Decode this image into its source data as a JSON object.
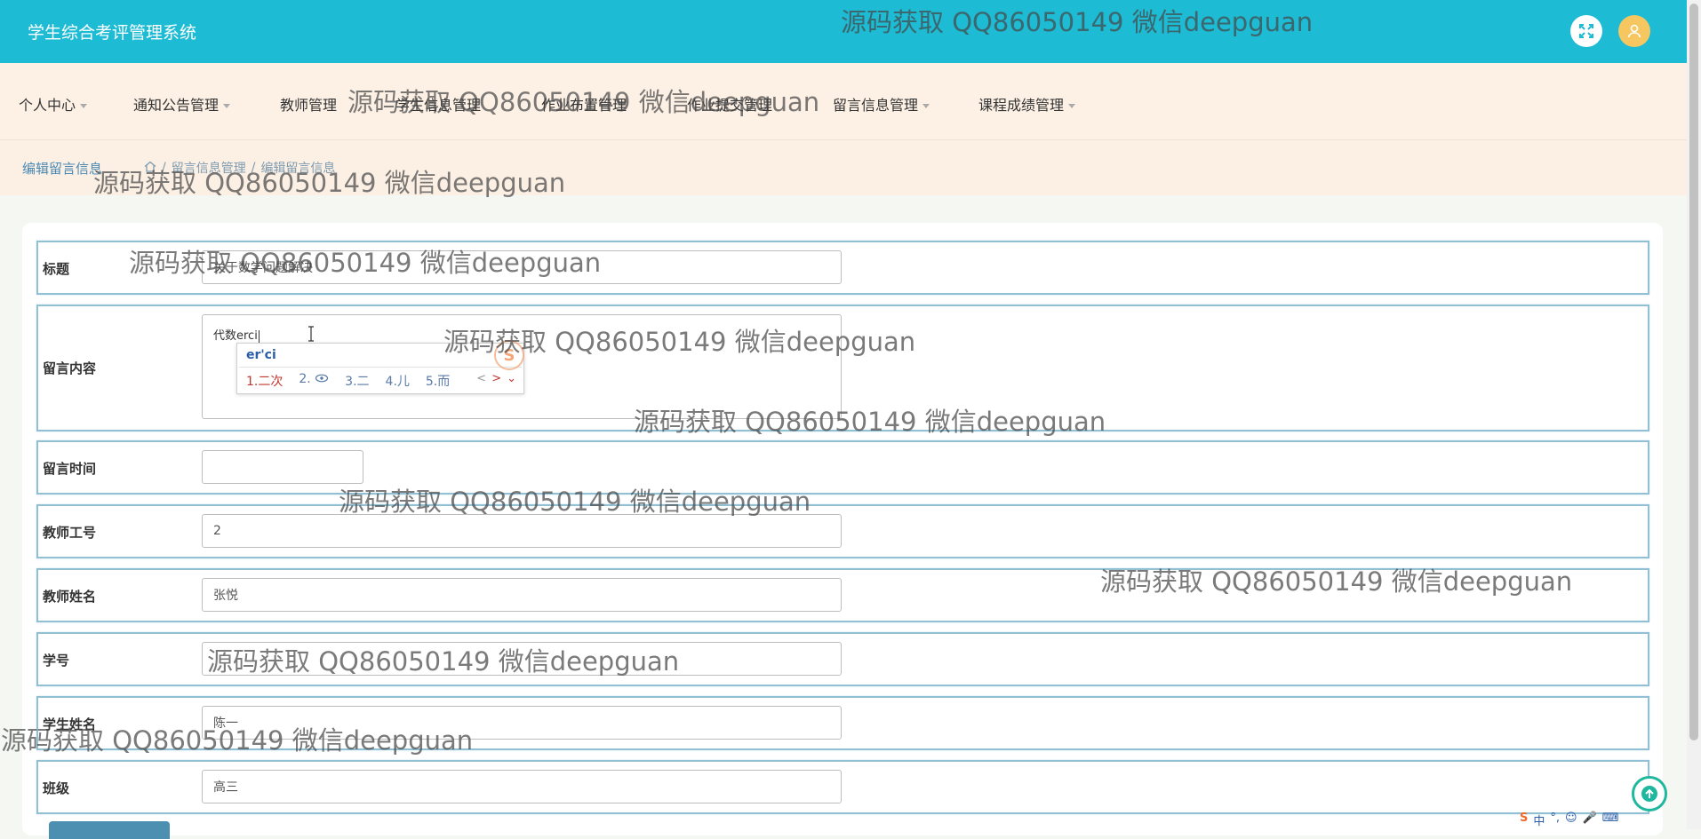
{
  "header": {
    "app_title": "学生综合考评管理系统"
  },
  "nav": [
    {
      "label": "个人中心"
    },
    {
      "label": "通知公告管理"
    },
    {
      "label": "教师管理"
    },
    {
      "label": "学生信息管理"
    },
    {
      "label": "作业布置管理"
    },
    {
      "label": "作业提交管理"
    },
    {
      "label": "留言信息管理"
    },
    {
      "label": "课程成绩管理"
    }
  ],
  "breadcrumb": {
    "title": "编辑留言信息",
    "path_section": "留言信息管理",
    "path_sep": "/",
    "path_current": "编辑留言信息"
  },
  "form": {
    "title": {
      "label": "标题",
      "value": "关于数学问题解决"
    },
    "content": {
      "label": "留言内容",
      "value": "代数erci"
    },
    "time": {
      "label": "留言时间",
      "value": ""
    },
    "teacher_id": {
      "label": "教师工号",
      "value": "2"
    },
    "teacher_name": {
      "label": "教师姓名",
      "value": "张悦"
    },
    "student_id": {
      "label": "学号",
      "value": ""
    },
    "student_name": {
      "label": "学生姓名",
      "value": "陈一"
    },
    "class": {
      "label": "班级",
      "value": "高三"
    }
  },
  "ime": {
    "input": "er'ci",
    "candidates": [
      "1.二次",
      "2.",
      "3.二",
      "4.儿",
      "5.而"
    ],
    "nav": [
      "<",
      ">",
      "⌄"
    ]
  },
  "tray": {
    "items": [
      "中",
      "°,",
      "☺",
      "🎤",
      "⌨"
    ]
  },
  "watermark": {
    "text": "源码获取 QQ86050149 微信deepguan"
  },
  "colors": {
    "header": "#1ebbd4",
    "nav_bg": "#fdf1e6",
    "row_border": "#91bfd3",
    "accent": "#1fb89e"
  }
}
